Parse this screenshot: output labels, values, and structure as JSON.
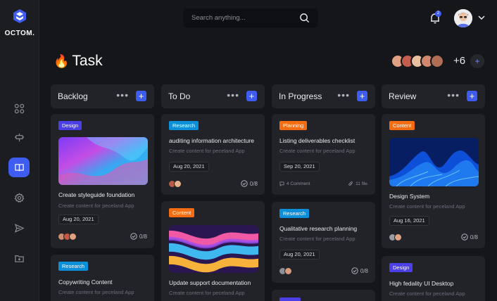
{
  "brand": {
    "name": "OCTOM."
  },
  "search": {
    "placeholder": "Search anything..."
  },
  "notifications": {
    "count": "2"
  },
  "page": {
    "title": "Task",
    "team_more": "+6",
    "team_add": "+"
  },
  "sidebar": {
    "items": [
      {
        "icon": "grid-icon",
        "active": false
      },
      {
        "icon": "sign-icon",
        "active": false
      },
      {
        "icon": "book-icon",
        "active": true
      },
      {
        "icon": "gear-icon",
        "active": false
      },
      {
        "icon": "send-icon",
        "active": false
      },
      {
        "icon": "folder-icon",
        "active": false
      }
    ]
  },
  "columns": [
    {
      "title": "Backlog",
      "dots": "•••",
      "add": "+"
    },
    {
      "title": "To Do",
      "dots": "•••",
      "add": "+"
    },
    {
      "title": "In Progress",
      "dots": "•••",
      "add": "+"
    },
    {
      "title": "Review",
      "dots": "•••",
      "add": "+"
    }
  ],
  "cards": {
    "backlog_1": {
      "tag": "Design",
      "title": "Create styleguide foundation",
      "subtitle": "Create content for peceland App",
      "date": "Aug 20, 2021",
      "progress": "0/8"
    },
    "backlog_2": {
      "tag": "Research",
      "title": "Copywriting Content",
      "subtitle": "Create content for peceland App"
    },
    "todo_1": {
      "tag": "Research",
      "title": "auditing information architecture",
      "subtitle": "Create content for peceland App",
      "date": "Aug 20, 2021",
      "progress": "0/8"
    },
    "todo_2": {
      "tag": "Content",
      "title": "Update support documentation",
      "subtitle": "Create content for peceland App"
    },
    "inprogress_1": {
      "tag": "Planning",
      "title": "Listing deliverables checklist",
      "subtitle": "Create content for peceland App",
      "date": "Sep 20, 2021",
      "comments": "4 Comment",
      "files": "11 file"
    },
    "inprogress_2": {
      "tag": "Research",
      "title": "Qualitative research planning",
      "subtitle": "Create content for peceland App",
      "date": "Aug 20, 2021",
      "progress": "0/8"
    },
    "review_1": {
      "tag": "Content",
      "title": "Design System",
      "subtitle": "Create content for peceland App",
      "date": "Aug 16, 2021",
      "progress": "0/8"
    },
    "review_2": {
      "tag": "Design",
      "title": "High fedality UI Desktop",
      "subtitle": "Create content for peceland App"
    }
  },
  "colors": {
    "accent": "#3f5cf0",
    "purple_tag": "#4c3fe6",
    "blue_tag": "#0b8fd9",
    "orange_tag": "#f46d13",
    "background": "#15161a",
    "card": "#222328"
  }
}
